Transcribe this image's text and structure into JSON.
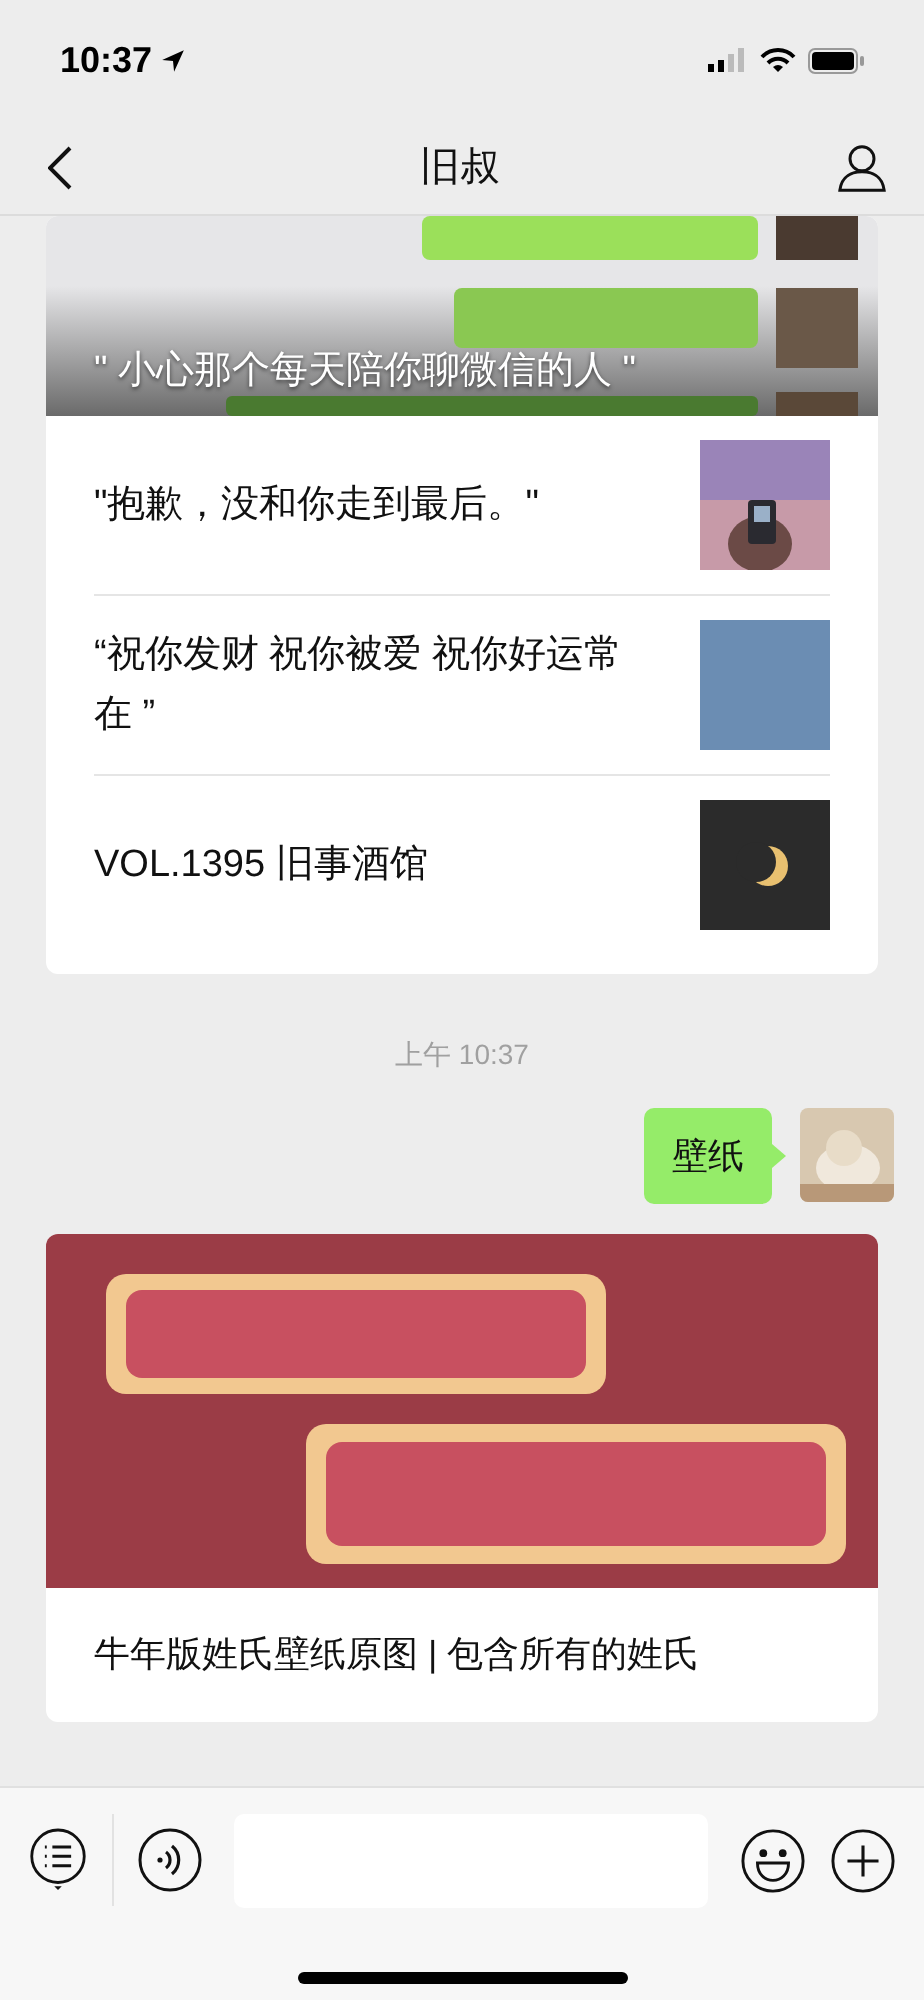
{
  "status_bar": {
    "time": "10:37"
  },
  "nav": {
    "title": "旧叔"
  },
  "messages": [
    {
      "kind": "articles",
      "cover_title": "\" 小心那个每天陪你聊微信的人 \"",
      "items": [
        {
          "title": "\"抱歉，没和你走到最后。\""
        },
        {
          "title": "“祝你发财 祝你被爱 祝你好运常在 ”"
        },
        {
          "title": "VOL.1395 旧事酒馆"
        }
      ]
    },
    {
      "kind": "timestamp",
      "text": "上午 10:37"
    },
    {
      "kind": "text",
      "text": "壁纸"
    },
    {
      "kind": "article",
      "title": "牛年版姓氏壁纸原图 | 包含所有的姓氏"
    }
  ]
}
